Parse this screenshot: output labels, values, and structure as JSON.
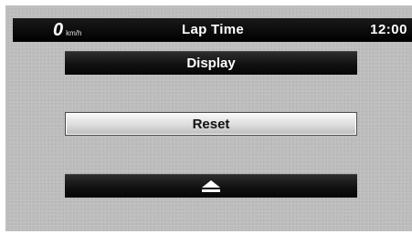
{
  "status_bar": {
    "speed_value": "0",
    "speed_unit": "km/h",
    "title": "Lap Time",
    "clock": "12:00"
  },
  "menu": {
    "items": [
      {
        "label": "Display",
        "selected": false
      },
      {
        "label": "Reset",
        "selected": true
      },
      {
        "label": "",
        "icon": "eject-icon",
        "selected": false
      }
    ]
  },
  "colors": {
    "screen_background": "#bdbdbd",
    "bar_background": "#000000",
    "button_dark": "#111111",
    "button_selected": "#dcdcdc",
    "text_light": "#ffffff",
    "text_dark": "#111111"
  }
}
